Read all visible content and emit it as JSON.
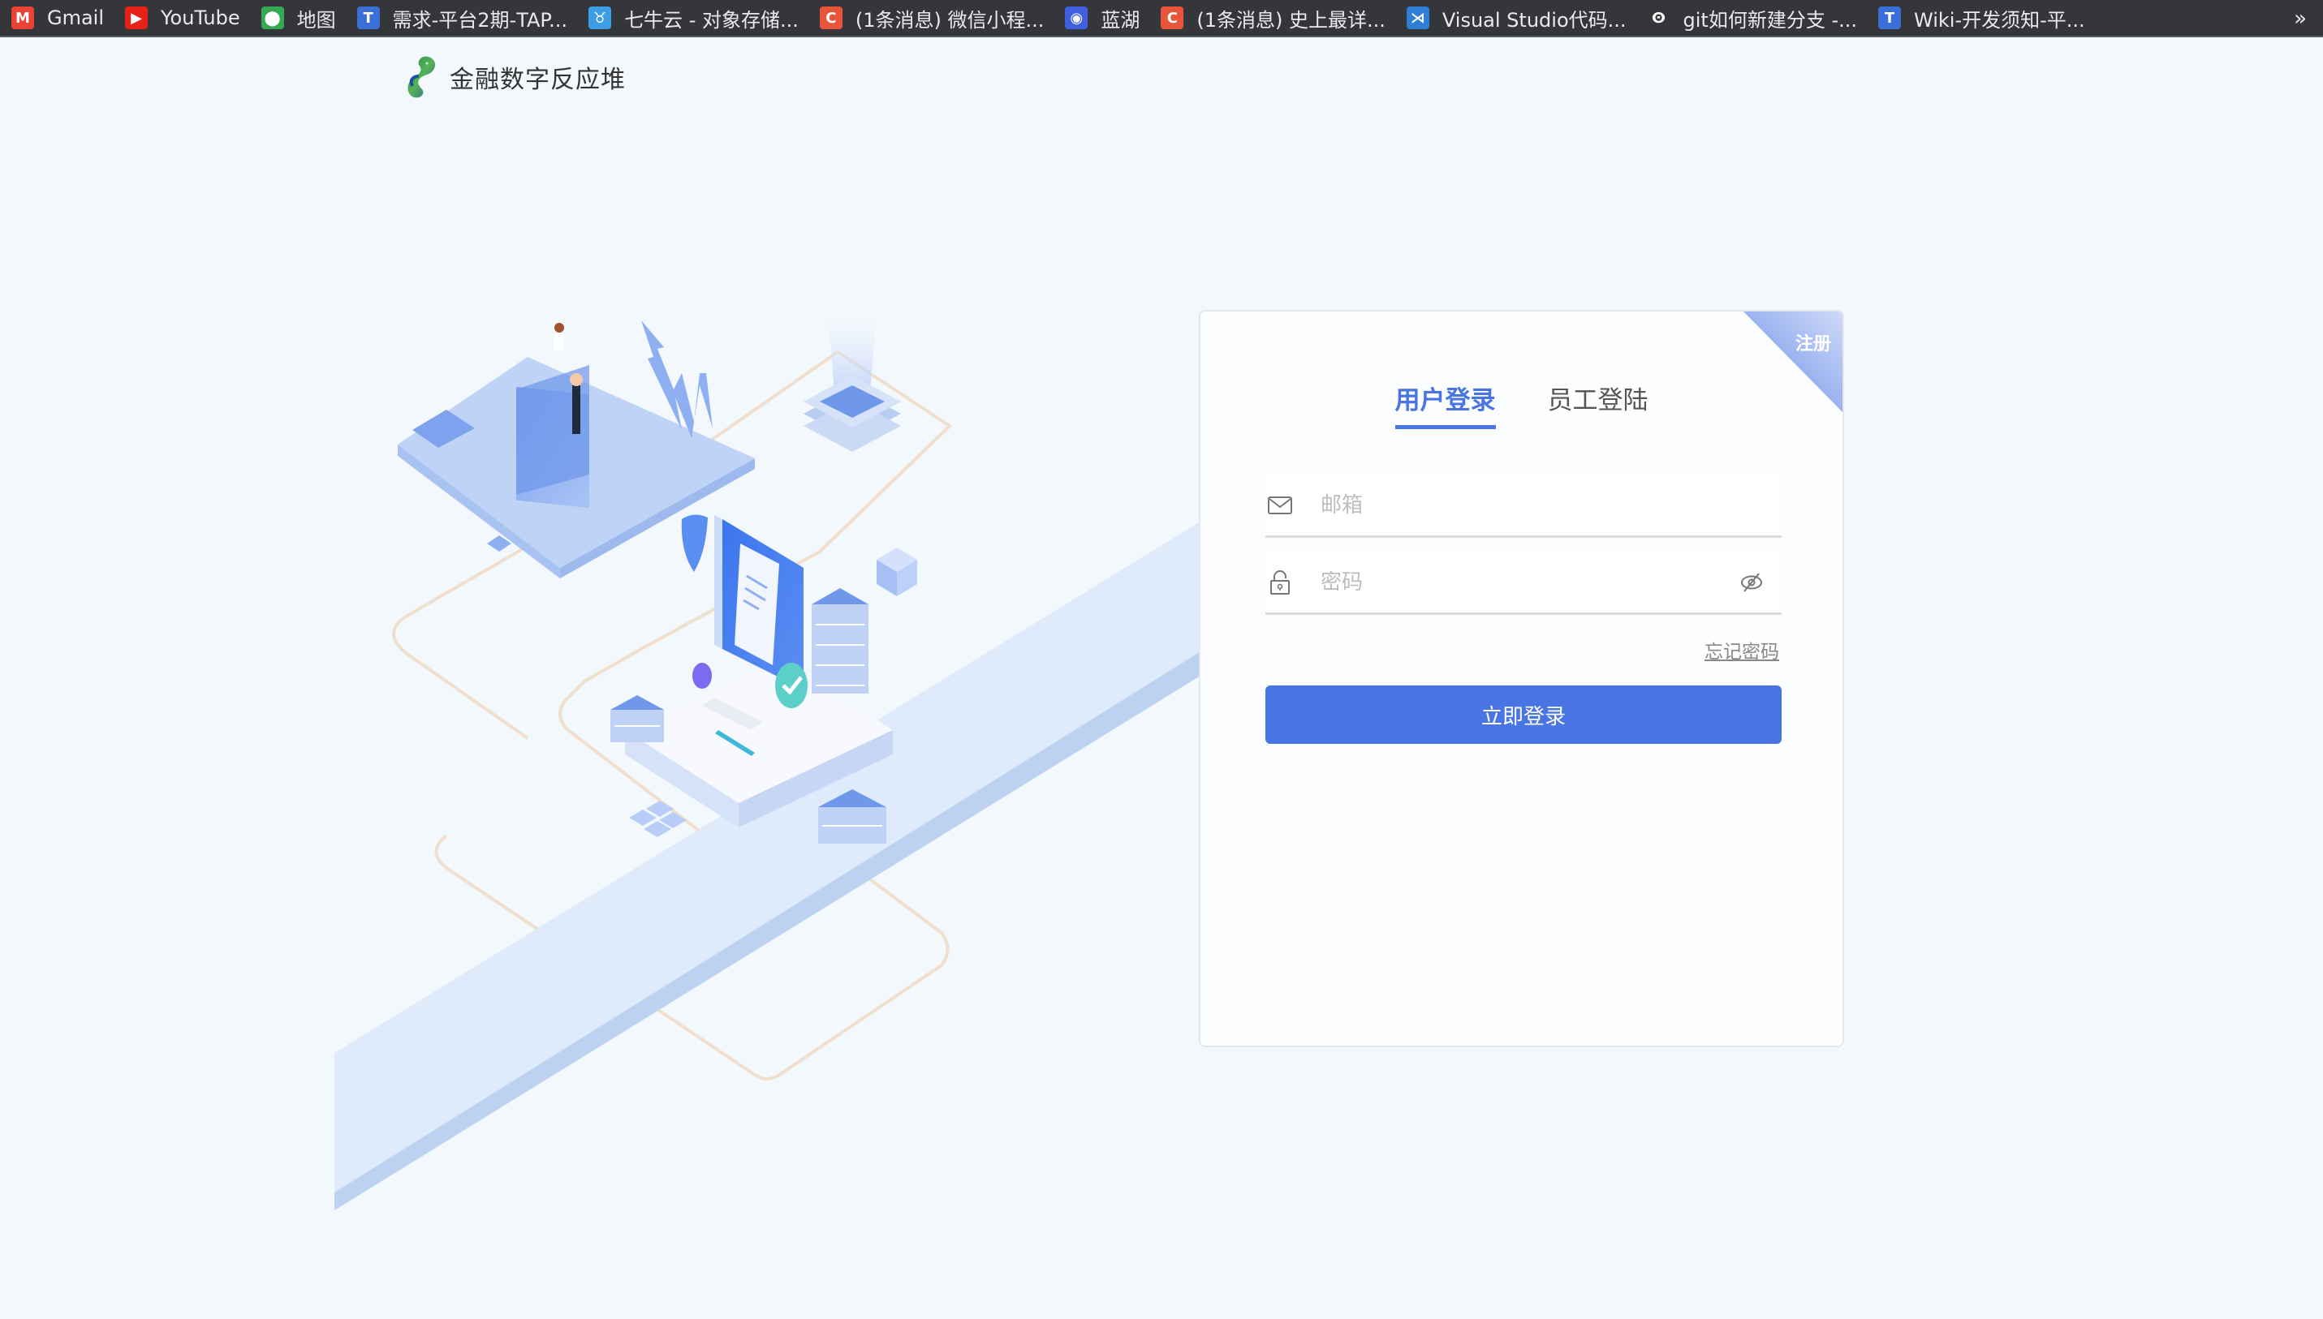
{
  "browser": {
    "bookmarks": [
      {
        "label": "Gmail",
        "icon": "gmail-icon",
        "color": "#ea4335",
        "glyph": "M"
      },
      {
        "label": "YouTube",
        "icon": "youtube-icon",
        "color": "#e62117",
        "glyph": "▶"
      },
      {
        "label": "地图",
        "icon": "maps-icon",
        "color": "#34a853",
        "glyph": "⬤"
      },
      {
        "label": "需求-平台2期-TAP...",
        "icon": "tapd-icon",
        "color": "#3b6fd8",
        "glyph": "T"
      },
      {
        "label": "七牛云 - 对象存储...",
        "icon": "qiniu-icon",
        "color": "#3c9ee6",
        "glyph": "♉"
      },
      {
        "label": "(1条消息) 微信小程...",
        "icon": "csdn-icon",
        "color": "#e8553a",
        "glyph": "C"
      },
      {
        "label": "蓝湖",
        "icon": "lanhu-icon",
        "color": "#3f5fe0",
        "glyph": "◉"
      },
      {
        "label": "(1条消息) 史上最详...",
        "icon": "csdn-icon",
        "color": "#e8553a",
        "glyph": "C"
      },
      {
        "label": "Visual Studio代码...",
        "icon": "vscode-icon",
        "color": "#2d7fd6",
        "glyph": "⋊"
      },
      {
        "label": "git如何新建分支 -...",
        "icon": "git-icon",
        "color": "#35363a",
        "glyph": "ⵙ"
      },
      {
        "label": "Wiki-开发须知-平...",
        "icon": "tapd-icon",
        "color": "#3b6fd8",
        "glyph": "T"
      }
    ],
    "more_label": "»"
  },
  "header": {
    "logo_text": "金融数字反应堆"
  },
  "login": {
    "register_label": "注册",
    "tabs": [
      {
        "label": "用户登录",
        "active": true
      },
      {
        "label": "员工登陆",
        "active": false
      }
    ],
    "email": {
      "placeholder": "邮箱",
      "value": "",
      "icon": "mail-icon"
    },
    "password": {
      "placeholder": "密码",
      "value": "",
      "icon": "lock-icon",
      "toggle_icon": "eye-off-icon"
    },
    "forgot_label": "忘记密码",
    "submit_label": "立即登录"
  },
  "colors": {
    "accent": "#4874e4",
    "page_bg": "#f3f8fc",
    "bookmark_bar": "#35363a"
  }
}
